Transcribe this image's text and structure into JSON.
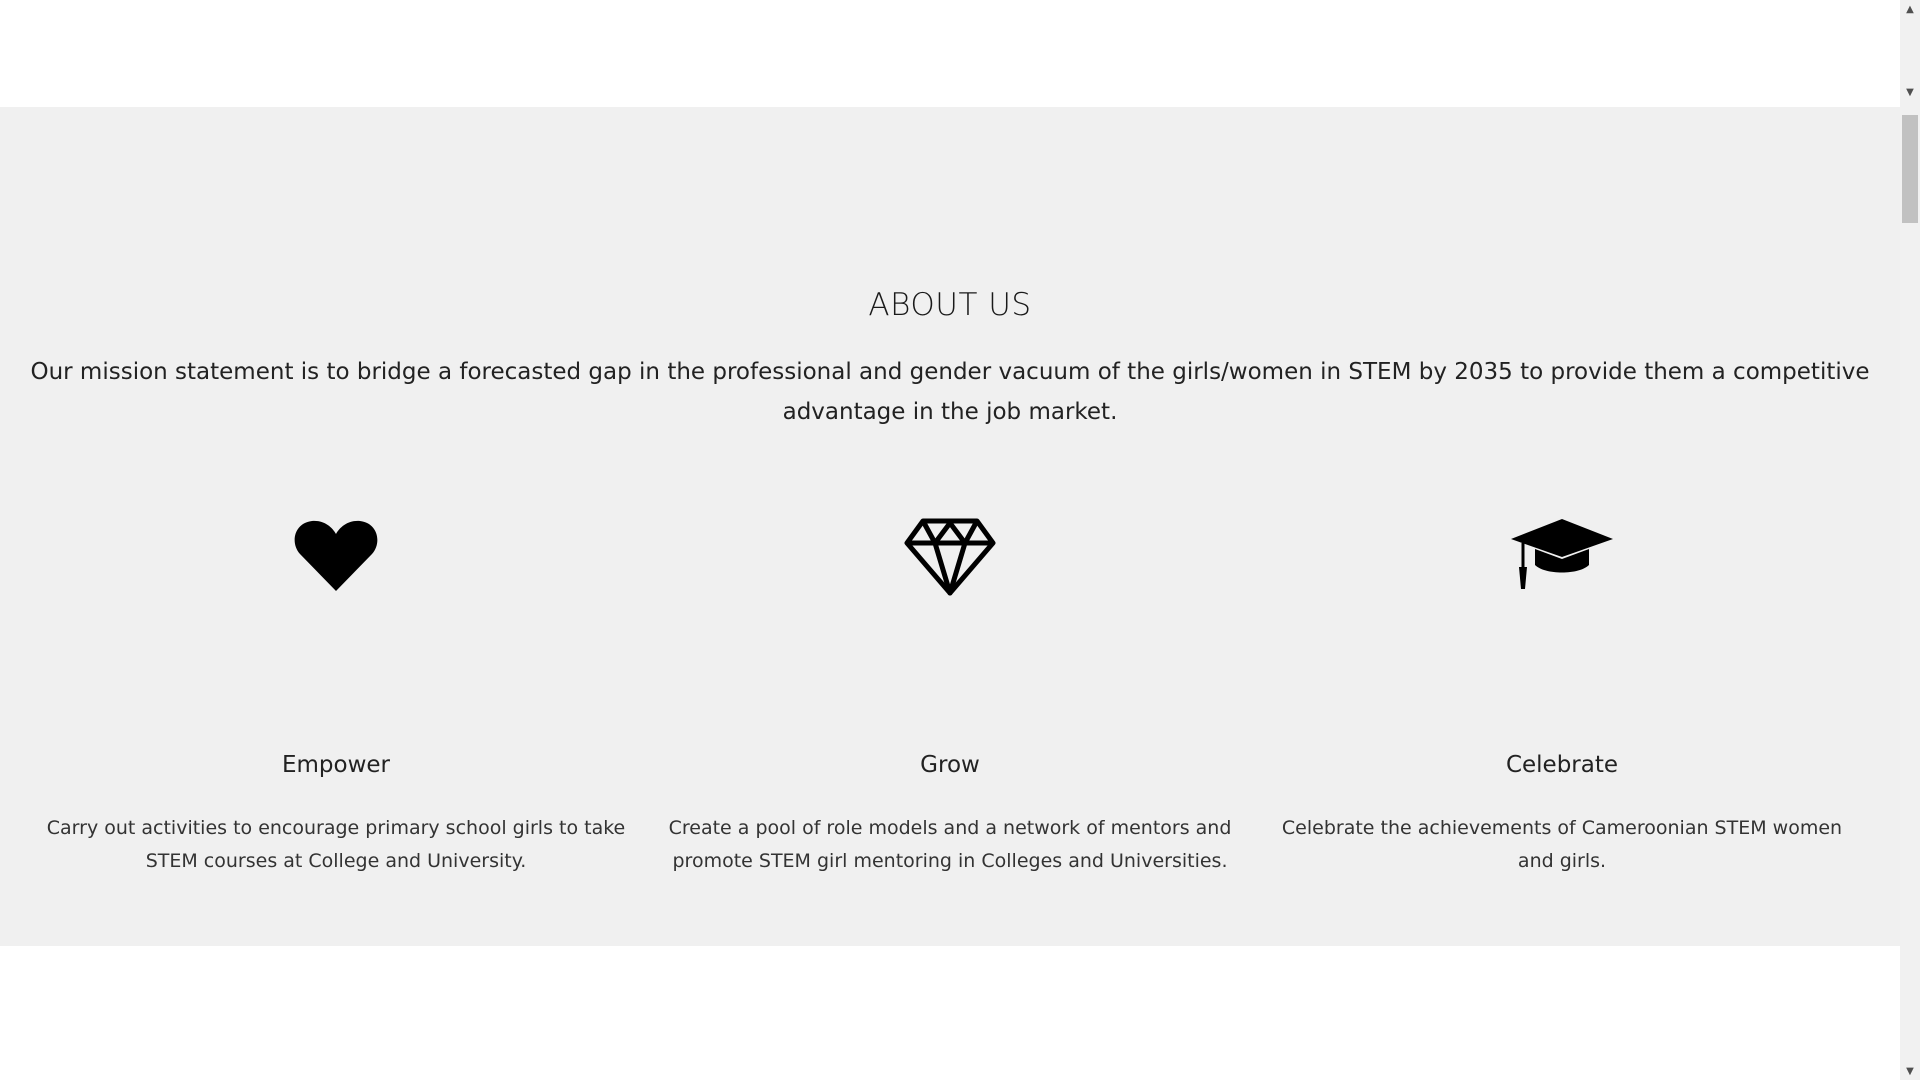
{
  "about": {
    "title": "ABOUT US",
    "mission": "Our mission statement is to bridge a forecasted gap in the professional and gender vacuum of the girls/women in STEM by 2035 to provide them a competitive advantage in the job market.",
    "features": [
      {
        "icon": "heart-icon",
        "title": "Empower",
        "text": "Carry out activities to encourage primary school girls to take STEM courses at College and University."
      },
      {
        "icon": "diamond-icon",
        "title": "Grow",
        "text": "Create a pool of role models and a network of mentors and promote STEM girl mentoring in Colleges and Universities."
      },
      {
        "icon": "graduation-cap-icon",
        "title": "Celebrate",
        "text": "Celebrate the achievements of Cameroonian STEM women and girls."
      }
    ]
  },
  "scrollbar": {
    "up_arrow": "▲",
    "down_arrow": "▼"
  },
  "colors": {
    "section_background": "#f0f0f0",
    "page_background": "#ffffff",
    "text": "#222222"
  }
}
